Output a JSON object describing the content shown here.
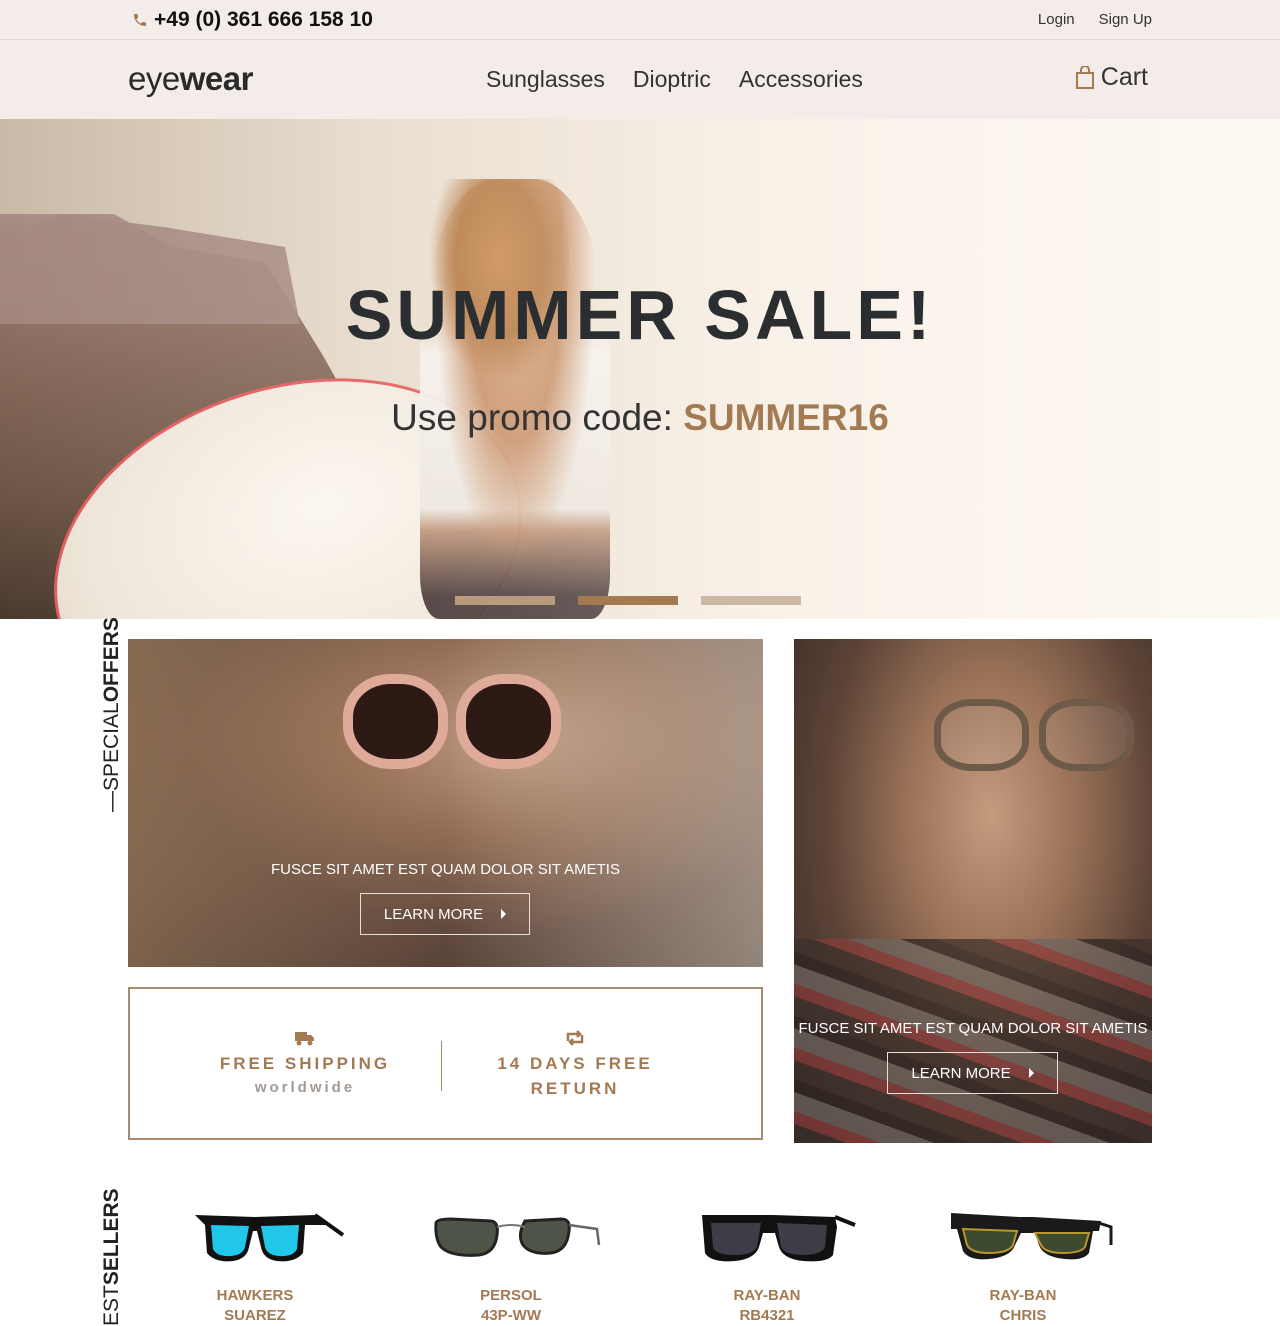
{
  "topbar": {
    "phone": "+49 (0) 361 666 158 10",
    "login": "Login",
    "signup": "Sign Up"
  },
  "nav": {
    "logo_light": "eye",
    "logo_bold": "wear",
    "items": [
      {
        "label": "Sunglasses"
      },
      {
        "label": "Dioptric"
      },
      {
        "label": "Accessories"
      }
    ],
    "cart": "Cart"
  },
  "hero": {
    "title": "SUMMER SALE!",
    "promo_label": "Use promo code: ",
    "promo_code": "SUMMER16",
    "slides": [
      {
        "state": "inactive",
        "color": "#b99a7c"
      },
      {
        "state": "active",
        "color": "#a37a52"
      },
      {
        "state": "inactive",
        "color": "#cdb8a3"
      }
    ]
  },
  "special_offers": {
    "label_light": "SPECIAL",
    "label_bold": "OFFERS",
    "offer1": {
      "text": "FUSCE SIT AMET EST QUAM DOLOR SIT AMETIS",
      "button": "LEARN MORE"
    },
    "offer2": {
      "text": "FUSCE SIT AMET EST QUAM DOLOR SIT AMETIS",
      "button": "LEARN MORE"
    }
  },
  "shipping": {
    "free_shipping": "FREE SHIPPING",
    "worldwide": "worldwide",
    "return_line1": "14 DAYS FREE",
    "return_line2": "RETURN"
  },
  "bestsellers": {
    "label_light": "EST",
    "label_bold": "SELLERS",
    "products": [
      {
        "brand": "HAWKERS",
        "model": "SUAREZ"
      },
      {
        "brand": "PERSOL",
        "model": "43P-WW"
      },
      {
        "brand": "RAY-BAN",
        "model": "RB4321"
      },
      {
        "brand": "RAY-BAN",
        "model": "CHRIS"
      }
    ]
  },
  "colors": {
    "accent": "#a37a52",
    "topbar_bg": "#f3ece8",
    "text_dark": "#2b2e31"
  }
}
